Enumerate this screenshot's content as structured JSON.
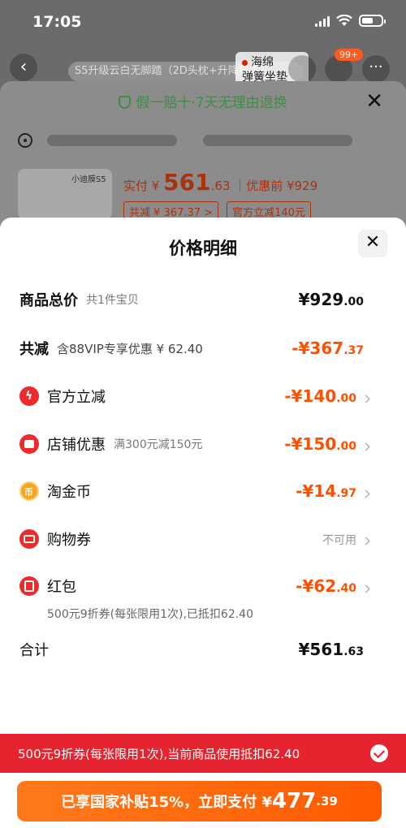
{
  "status_bar": {
    "time": "17:05"
  },
  "background": {
    "nav": {
      "back_icon": "chevron-left-icon",
      "title": "S5升级云白无脚踏（2D头枕+升降扶手）",
      "ad_line1": "海绵",
      "ad_line2": "弹簧坐垫",
      "cart_badge": "99+",
      "more_icon": "more-icon"
    },
    "guarantee": "假一赔十·7天无理由退换",
    "product_thumb_label": "小迪膜S5",
    "paid_label": "实付 ¥ ",
    "paid_int": "561",
    "paid_dec": ".63",
    "orig_price": "｜优惠前 ¥929",
    "chip_reduce": "共减 ¥ 367.37 >",
    "chip_official": "官方立减140元"
  },
  "modal": {
    "title": "价格明细",
    "total": {
      "label": "商品总价",
      "sub": "共1件宝贝",
      "amount_int": "¥929",
      "amount_dec": ".00"
    },
    "reduced": {
      "label": "共减",
      "sub": "含88VIP专享优惠 ¥ 62.40",
      "amount_int": "-¥367",
      "amount_dec": ".37"
    },
    "items": [
      {
        "label": "官方立减",
        "sub": "",
        "amount_int": "-¥140",
        "amount_dec": ".00",
        "icon": "lightning-icon"
      },
      {
        "label": "店铺优惠",
        "sub": "满300元减150元",
        "amount_int": "-¥150",
        "amount_dec": ".00",
        "icon": "shop-icon"
      },
      {
        "label": "淘金币",
        "sub": "",
        "amount_int": "-¥14",
        "amount_dec": ".97",
        "icon": "coin-icon"
      },
      {
        "label": "购物券",
        "sub": "",
        "status": "不可用",
        "icon": "coupon-icon"
      },
      {
        "label": "红包",
        "sub": "",
        "amount_int": "-¥62",
        "amount_dec": ".40",
        "icon": "red-envelope-icon"
      }
    ],
    "hongbao_note": "500元9折券(每张限用1次),已抵扣62.40",
    "sum": {
      "label": "合计",
      "amount_int": "¥561",
      "amount_dec": ".63"
    },
    "hongbao_bar": "500元9折券(每张限用1次),当前商品使用抵扣62.40",
    "pay_button": {
      "prefix": "已享国家补贴15%，立即支付 ¥",
      "int": "477",
      "dec": ".39"
    }
  },
  "colors": {
    "accent": "#ff5000",
    "red": "#e5242f",
    "green": "#3f8e45"
  }
}
